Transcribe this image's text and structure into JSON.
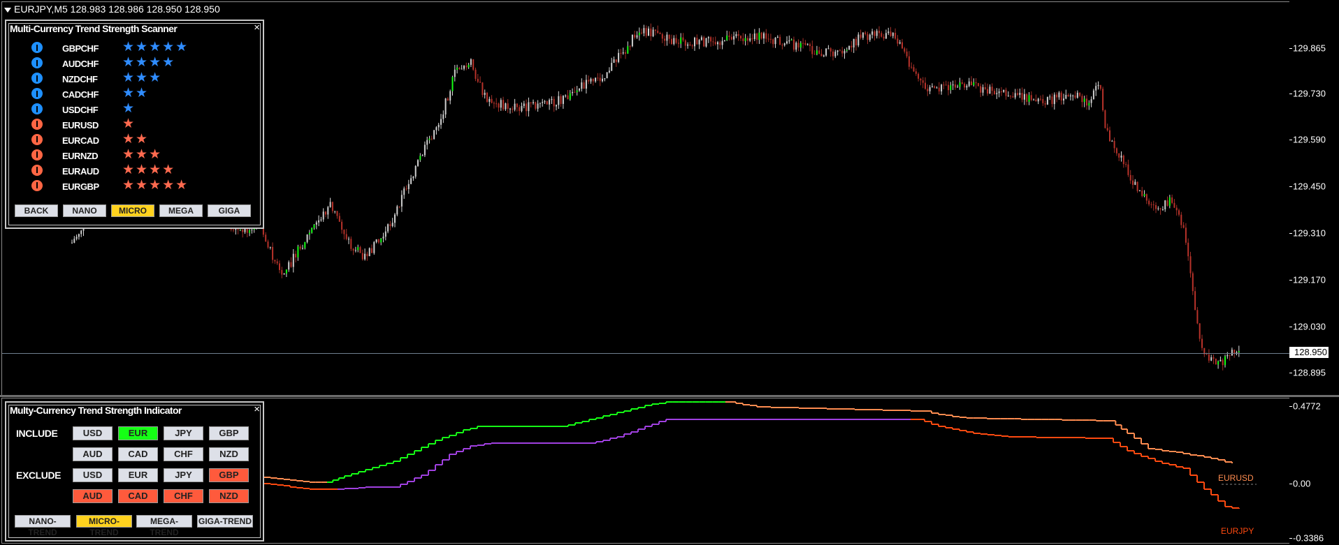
{
  "window": {
    "symbol_line": "EURJPY,M5  128.983 128.986 128.950 128.950"
  },
  "main_scale": {
    "labels": [
      "129.865",
      "129.730",
      "129.590",
      "129.450",
      "129.310",
      "129.170",
      "129.030",
      "128.895"
    ],
    "current_price": "128.950"
  },
  "sub_scale": {
    "labels": [
      "0.4772",
      "0.00",
      "-0.3386"
    ]
  },
  "scanner": {
    "title": "Multi-Currency Trend Strength Scanner",
    "close": "×",
    "rows": [
      {
        "pair": "GBPCHF",
        "dir": "up",
        "icon": "info-up-icon",
        "stars": "★★★★★"
      },
      {
        "pair": "AUDCHF",
        "dir": "up",
        "icon": "info-up-icon",
        "stars": "★★★★"
      },
      {
        "pair": "NZDCHF",
        "dir": "up",
        "icon": "info-up-icon",
        "stars": "★★★"
      },
      {
        "pair": "CADCHF",
        "dir": "up",
        "icon": "info-up-icon",
        "stars": "★★"
      },
      {
        "pair": "USDCHF",
        "dir": "up",
        "icon": "info-up-icon",
        "stars": "★"
      },
      {
        "pair": "EURUSD",
        "dir": "dn",
        "icon": "alert-down-icon",
        "stars": "★"
      },
      {
        "pair": "EURCAD",
        "dir": "dn",
        "icon": "alert-down-icon",
        "stars": "★★"
      },
      {
        "pair": "EURNZD",
        "dir": "dn",
        "icon": "alert-down-icon",
        "stars": "★★★"
      },
      {
        "pair": "EURAUD",
        "dir": "dn",
        "icon": "alert-down-icon",
        "stars": "★★★★"
      },
      {
        "pair": "EURGBP",
        "dir": "dn",
        "icon": "alert-down-icon",
        "stars": "★★★★★"
      }
    ],
    "buttons": [
      {
        "label": "BACK",
        "selected": false
      },
      {
        "label": "NANO",
        "selected": false
      },
      {
        "label": "MICRO",
        "selected": true
      },
      {
        "label": "MEGA",
        "selected": false
      },
      {
        "label": "GIGA",
        "selected": false
      }
    ]
  },
  "indicator": {
    "title": "Multy-Currency Trend Strength Indicator",
    "close": "×",
    "include_label": "INCLUDE",
    "exclude_label": "EXCLUDE",
    "include": [
      {
        "label": "USD",
        "state": "off"
      },
      {
        "label": "EUR",
        "state": "on"
      },
      {
        "label": "JPY",
        "state": "off"
      },
      {
        "label": "GBP",
        "state": "off"
      },
      {
        "label": "AUD",
        "state": "off"
      },
      {
        "label": "CAD",
        "state": "off"
      },
      {
        "label": "CHF",
        "state": "off"
      },
      {
        "label": "NZD",
        "state": "off"
      }
    ],
    "exclude": [
      {
        "label": "USD",
        "state": "off"
      },
      {
        "label": "EUR",
        "state": "off"
      },
      {
        "label": "JPY",
        "state": "off"
      },
      {
        "label": "GBP",
        "state": "on"
      },
      {
        "label": "AUD",
        "state": "on"
      },
      {
        "label": "CAD",
        "state": "on"
      },
      {
        "label": "CHF",
        "state": "on"
      },
      {
        "label": "NZD",
        "state": "on"
      }
    ],
    "trend_buttons": [
      {
        "label": "NANO-TREND",
        "selected": false
      },
      {
        "label": "MICRO-TREND",
        "selected": true
      },
      {
        "label": "MEGA-TREND",
        "selected": false
      },
      {
        "label": "GIGA-TREND",
        "selected": false
      }
    ],
    "line_labels": {
      "eurusd": "EURUSD",
      "eurjpy": "EURJPY"
    }
  },
  "colors": {
    "up_bullish": "#15ff15",
    "up": "#2f8cff",
    "down": "#ff6a4f",
    "selected": "#ffd21e",
    "eurusd_line": "#ff8c50",
    "eurjpy_line": "#ff4a10",
    "purple_line": "#a040e0"
  }
}
